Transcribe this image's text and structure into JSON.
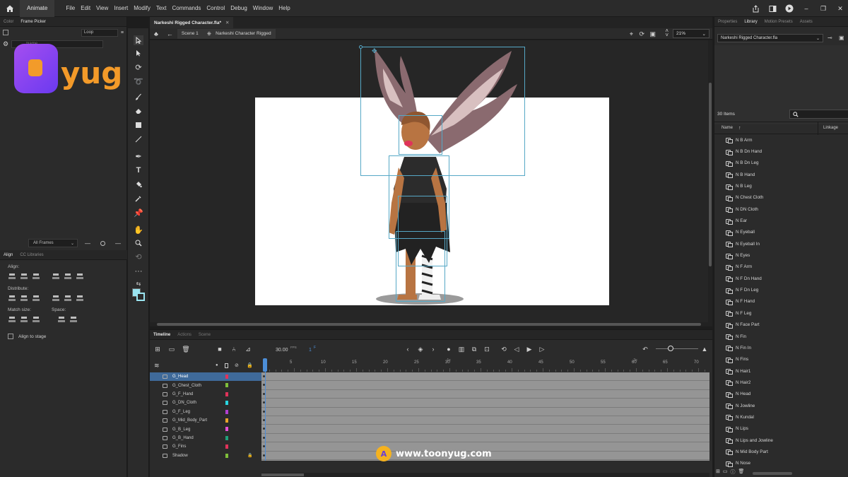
{
  "menubar": {
    "app_tab": "Animate",
    "menus": [
      "File",
      "Edit",
      "View",
      "Insert",
      "Modify",
      "Text",
      "Commands",
      "Control",
      "Debug",
      "Window",
      "Help"
    ]
  },
  "left_panel": {
    "tabs": [
      "Color",
      "Frame Picker"
    ],
    "loop_label": "Loop",
    "name_placeholder": "Name",
    "all_frames": "All Frames",
    "bottom_tabs": [
      "Align",
      "CC Libraries"
    ],
    "align_label": "Align:",
    "distribute_label": "Distribute:",
    "match_size_label": "Match size:",
    "space_label": "Space:",
    "align_to_stage": "Align to stage"
  },
  "document": {
    "tab_title": "Narkeshi Rigged Character.fla*",
    "scene": "Scene 1",
    "symbol": "Narkeshi Character Rigged",
    "zoom": "21%"
  },
  "timeline": {
    "tabs": [
      "Timeline",
      "Actions",
      "Scene"
    ],
    "fps": "30.00",
    "fps_unit": "FPS",
    "current_frame": "1",
    "frame_unit": "F",
    "ruler_numbers": [
      "5",
      "10",
      "15",
      "20",
      "25",
      "30",
      "35",
      "40",
      "45",
      "50",
      "55",
      "60",
      "65",
      "70"
    ],
    "ruler_seconds": [
      "1s",
      "2s"
    ],
    "layers": [
      {
        "name": "G_Head",
        "color": "#e0335a",
        "selected": true,
        "locked": false
      },
      {
        "name": "G_Chest_Cloth",
        "color": "#7fbf3a",
        "selected": false,
        "locked": false
      },
      {
        "name": "G_F_Hand",
        "color": "#e0335a",
        "selected": false,
        "locked": false
      },
      {
        "name": "G_DN_Cloth",
        "color": "#29d6e0",
        "selected": false,
        "locked": false
      },
      {
        "name": "G_F_Leg",
        "color": "#b13fd0",
        "selected": false,
        "locked": false
      },
      {
        "name": "G_Mid_Body_Part",
        "color": "#e8a52a",
        "selected": false,
        "locked": false
      },
      {
        "name": "G_B_Leg",
        "color": "#e64fd8",
        "selected": false,
        "locked": false
      },
      {
        "name": "G_B_Hand",
        "color": "#1fa07a",
        "selected": false,
        "locked": false
      },
      {
        "name": "G_Fins",
        "color": "#e0335a",
        "selected": false,
        "locked": false
      },
      {
        "name": "Shadow",
        "color": "#7fbf3a",
        "selected": false,
        "locked": true
      }
    ]
  },
  "right_panel": {
    "tabs": [
      "Properties",
      "Library",
      "Motion Presets",
      "Assets"
    ],
    "library_file": "Narkeshi Rigged Character.fla",
    "item_count": "30 Items",
    "col_name": "Name",
    "col_linkage": "Linkage",
    "items": [
      "N B Arm",
      "N B Dn Hand",
      "N B Dn Leg",
      "N B Hand",
      "N B Leg",
      "N Chest Cloth",
      "N DN Cloth",
      "N Ear",
      "N Eyeball",
      "N Eyeball In",
      "N Eyes",
      "N F Arm",
      "N F Dn Hand",
      "N F Dn Leg",
      "N F Hand",
      "N F Leg",
      "N Face Part",
      "N Fin",
      "N Fin In",
      "N Fins",
      "N Hair1",
      "N Hair2",
      "N Head",
      "N Jowline",
      "N Kundal",
      "N Lips",
      "N Lips and Jowline",
      "N Mid Body Part",
      "N Nose"
    ]
  },
  "watermark": {
    "logo_text": "yug",
    "site_url": "www.toonyug.com"
  },
  "colors": {
    "accent": "#4c8ed8",
    "selection": "#3f6a9a",
    "bounding_box": "#56a8c6"
  }
}
